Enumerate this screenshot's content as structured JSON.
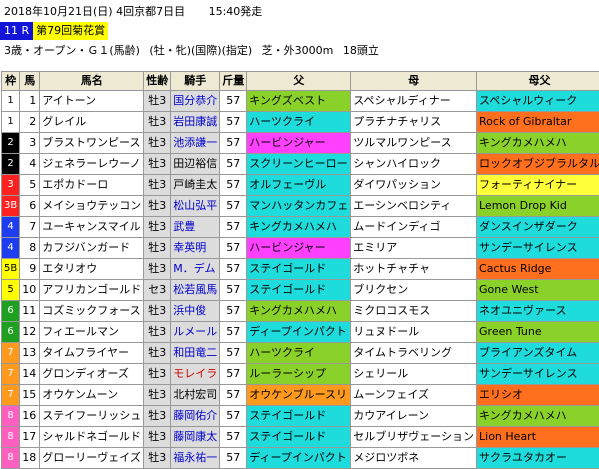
{
  "header": {
    "date_line": "2018年10月21日(日) 4回京都7日目",
    "start_time": "15:40発走",
    "race_number": "11 R",
    "race_title": "第79回菊花賞",
    "conditions": [
      "3歳・オープン・Ｇ１(馬齢)",
      "(牡・牝)(国際)(指定)",
      "芝・外3000m",
      "18頭立"
    ]
  },
  "table": {
    "headers": [
      "枠",
      "馬",
      "馬名",
      "性齢",
      "騎手",
      "斤量",
      "父",
      "母",
      "母父"
    ],
    "rows": [
      {
        "waku": "1",
        "uma": "1",
        "name": "アイトーン",
        "sexage": "牡3",
        "jockey": "国分恭介",
        "weight": "57",
        "sire": "キングズベスト",
        "dam": "スペシャルディナー",
        "damsire": "スペシャルウィーク"
      },
      {
        "waku": "1",
        "uma": "2",
        "name": "グレイル",
        "sexage": "牡3",
        "jockey": "岩田康誠",
        "weight": "57",
        "sire": "ハーツクライ",
        "dam": "プラチナチャリス",
        "damsire": "Rock of Gibraltar"
      },
      {
        "waku": "2",
        "uma": "3",
        "name": "ブラストワンピース",
        "sexage": "牡3",
        "jockey": "池添謙一",
        "weight": "57",
        "sire": "ハービンジャー",
        "dam": "ツルマルワンピース",
        "damsire": "キングカメハメハ"
      },
      {
        "waku": "2",
        "uma": "4",
        "name": "ジェネラーレウーノ",
        "sexage": "牡3",
        "jockey": "田辺裕信",
        "weight": "57",
        "sire": "スクリーンヒーロー",
        "dam": "シャンハイロック",
        "damsire": "ロックオブジブラルタル"
      },
      {
        "waku": "3",
        "uma": "5",
        "name": "エポカドーロ",
        "sexage": "牡3",
        "jockey": "戸崎圭太",
        "weight": "57",
        "sire": "オルフェーヴル",
        "dam": "ダイワパッション",
        "damsire": "フォーティナイナー"
      },
      {
        "waku": "3B",
        "uma": "6",
        "name": "メイショウテッコン",
        "sexage": "牡3",
        "jockey": "松山弘平",
        "weight": "57",
        "sire": "マンハッタンカフェ",
        "dam": "エーシンベロシティ",
        "damsire": "Lemon Drop Kid"
      },
      {
        "waku": "4",
        "uma": "7",
        "name": "ユーキャンスマイル",
        "sexage": "牡3",
        "jockey": "武豊",
        "weight": "57",
        "sire": "キングカメハメハ",
        "dam": "ムードインディゴ",
        "damsire": "ダンスインザダーク"
      },
      {
        "waku": "4",
        "uma": "8",
        "name": "カフジバンガード",
        "sexage": "牡3",
        "jockey": "幸英明",
        "weight": "57",
        "sire": "ハービンジャー",
        "dam": "エミリア",
        "damsire": "サンデーサイレンス"
      },
      {
        "waku": "5B",
        "uma": "9",
        "name": "エタリオウ",
        "sexage": "牡3",
        "jockey": "M．デム",
        "weight": "57",
        "sire": "ステイゴールド",
        "dam": "ホットチャチャ",
        "damsire": "Cactus Ridge"
      },
      {
        "waku": "5",
        "uma": "10",
        "name": "アフリカンゴールド",
        "sexage": "セ3",
        "jockey": "松若風馬",
        "weight": "57",
        "sire": "ステイゴールド",
        "dam": "ブリクセン",
        "damsire": "Gone West"
      },
      {
        "waku": "6",
        "uma": "11",
        "name": "コズミックフォース",
        "sexage": "牡3",
        "jockey": "浜中俊",
        "weight": "57",
        "sire": "キングカメハメハ",
        "dam": "ミクロコスモス",
        "damsire": "ネオユニヴァース"
      },
      {
        "waku": "6",
        "uma": "12",
        "name": "フィエールマン",
        "sexage": "牡3",
        "jockey": "ルメール",
        "weight": "57",
        "sire": "ディープインパクト",
        "dam": "リュヌドール",
        "damsire": "Green Tune"
      },
      {
        "waku": "7",
        "uma": "13",
        "name": "タイムフライヤー",
        "sexage": "牡3",
        "jockey": "和田竜二",
        "weight": "57",
        "sire": "ハーツクライ",
        "dam": "タイムトラベリング",
        "damsire": "ブライアンズタイム"
      },
      {
        "waku": "7",
        "uma": "14",
        "name": "グロンディオーズ",
        "sexage": "牡3",
        "jockey": "モレイラ",
        "weight": "57",
        "sire": "ルーラーシップ",
        "dam": "シェリール",
        "damsire": "サンデーサイレンス"
      },
      {
        "waku": "7",
        "uma": "15",
        "name": "オウケンムーン",
        "sexage": "牡3",
        "jockey": "北村宏司",
        "weight": "57",
        "sire": "オウケンブルースリ",
        "dam": "ムーンフェイズ",
        "damsire": "エリシオ"
      },
      {
        "waku": "8",
        "uma": "16",
        "name": "ステイフーリッシュ",
        "sexage": "牡3",
        "jockey": "藤岡佑介",
        "weight": "57",
        "sire": "ステイゴールド",
        "dam": "カウアイレーン",
        "damsire": "キングカメハメハ"
      },
      {
        "waku": "8",
        "uma": "17",
        "name": "シャルドネゴールド",
        "sexage": "牡3",
        "jockey": "藤岡康太",
        "weight": "57",
        "sire": "ステイゴールド",
        "dam": "セルブリザヴェーション",
        "damsire": "Lion Heart"
      },
      {
        "waku": "8",
        "uma": "18",
        "name": "グローリーヴェイズ",
        "sexage": "牡3",
        "jockey": "福永祐一",
        "weight": "57",
        "sire": "ディープインパクト",
        "dam": "メジロツボネ",
        "damsire": "サクラユタカオー"
      }
    ]
  },
  "colors": {
    "header_bg": "#eee9d3",
    "race_number_bg": "#1414d8",
    "race_title_bg": "#ffff00",
    "waku": {
      "1": {
        "bg": "#ffffff",
        "fg": "#000000"
      },
      "2": {
        "bg": "#000000",
        "fg": "#ffffff"
      },
      "3": {
        "bg": "#ff2020",
        "fg": "#ffffff"
      },
      "4": {
        "bg": "#1e3cf0",
        "fg": "#ffffff"
      },
      "5": {
        "bg": "#ffff00",
        "fg": "#000000"
      },
      "6": {
        "bg": "#20a020",
        "fg": "#ffffff"
      },
      "7": {
        "bg": "#ff9a1e",
        "fg": "#ffffff"
      },
      "8": {
        "bg": "#ff60c0",
        "fg": "#ffffff"
      }
    },
    "sire": [
      "#8ad22a",
      "#1edcdc",
      "#ff40ff",
      "#1edcdc",
      "#1edcdc",
      "#1edcdc",
      "#1edcdc",
      "#ff40ff",
      "#1edcdc",
      "#1edcdc",
      "#8ad22a",
      "#1edcdc",
      "#8ad22a",
      "#8ad22a",
      "#ff9a1e",
      "#1edcdc",
      "#1edcdc",
      "#1edcdc"
    ],
    "dam": [
      "#ffffff",
      "#ffffff",
      "#ffffff",
      "#ffffff",
      "#ffffff",
      "#ffffff",
      "#ffffff",
      "#ffffff",
      "#ffffff",
      "#ffffff",
      "#ffffff",
      "#ffffff",
      "#ffffff",
      "#ffffff",
      "#ffffff",
      "#ffffff",
      "#ffffff",
      "#ffffff"
    ],
    "damsire": [
      "#1edcdc",
      "#ff6f1e",
      "#8ad22a",
      "#ff6f1e",
      "#ffff3a",
      "#8ad22a",
      "#1edcdc",
      "#1edcdc",
      "#ff6f1e",
      "#8ad22a",
      "#1edcdc",
      "#8ad22a",
      "#1edcdc",
      "#1edcdc",
      "#ff6f1e",
      "#8ad22a",
      "#ff6f1e",
      "#1edcdc"
    ],
    "jockey_style": [
      "blue",
      "blue",
      "blue",
      "black",
      "black",
      "blue",
      "blue",
      "blue",
      "blue",
      "blue",
      "blue",
      "blue",
      "blue",
      "red",
      "black",
      "blue",
      "blue",
      "blue"
    ]
  }
}
